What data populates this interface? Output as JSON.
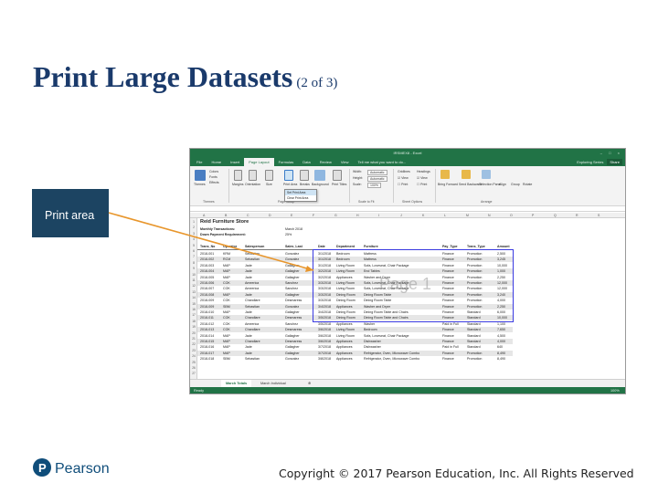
{
  "slide": {
    "title_main": "Print Large Datasets",
    "title_sub": "(2 of 3)",
    "callout": "Print area",
    "publisher": "Pearson",
    "copyright": "Copyright © 2017 Pearson Education, Inc. All Rights Reserved"
  },
  "excel": {
    "title": "IRSMEX8 - Excel",
    "tabs": [
      "File",
      "Home",
      "Insert",
      "Page Layout",
      "Formulas",
      "Data",
      "Review",
      "View"
    ],
    "active_tab": "Page Layout",
    "tell_me": "Tell me what you want to do...",
    "user": "Exploring Series",
    "share": "Share",
    "ribbon": {
      "themes": "Themes",
      "colors": "Colors",
      "fonts": "Fonts",
      "effects": "Effects",
      "margins": "Margins",
      "orientation": "Orientation",
      "size": "Size",
      "print_area": "Print Area",
      "breaks": "Breaks",
      "background": "Background",
      "print_titles": "Print Titles",
      "width": "Width:",
      "height": "Height:",
      "scale": "Scale:",
      "automatic": "Automatic",
      "scale_value": "100%",
      "gridlines": "Gridlines",
      "headings": "Headings",
      "view": "View",
      "print": "Print",
      "bring_forward": "Bring Forward",
      "send_backward": "Send Backward",
      "selection_pane": "Selection Pane",
      "align": "Align",
      "group": "Group",
      "rotate": "Rotate",
      "groups": [
        "Themes",
        "Page Setup",
        "Scale to Fit",
        "Sheet Options",
        "Arrange"
      ],
      "dropdown": [
        "Set Print Area",
        "Clear Print Area"
      ]
    },
    "columns": [
      "A",
      "B",
      "C",
      "D",
      "E",
      "F",
      "G",
      "H",
      "I",
      "J",
      "K",
      "L",
      "M",
      "N",
      "O",
      "P",
      "Q",
      "R",
      "S"
    ],
    "rows_header": [
      "1",
      "2",
      "3",
      "4",
      "5",
      "6",
      "7",
      "8",
      "9",
      "10",
      "11",
      "12",
      "13",
      "14",
      "15",
      "16",
      "17",
      "18",
      "19",
      "20",
      "21",
      "22",
      "23",
      "24",
      "25",
      "26",
      "27"
    ],
    "store_name": "Reid Furniture Store",
    "labels": {
      "monthly": "Monthly Transactions:",
      "month": "March 2018",
      "down_payment": "Down Payment Requirement:",
      "pct": "25%"
    },
    "table_headers": [
      "Trans_No",
      "Operator",
      "Salesperson",
      "Sales_Last",
      "Date",
      "Department",
      "Furniture",
      "Pay_Type",
      "Trans_Type",
      "Amount"
    ],
    "page_watermark": "Page 1",
    "data_rows": [
      [
        "2018-001",
        "KRM",
        "Sebastian",
        "Gonzalez",
        "3/1/2018",
        "Bedroom",
        "Mattress",
        "Finance",
        "Promotion",
        "2,500"
      ],
      [
        "2018-002",
        "RCM",
        "Sebastian",
        "Gonzalez",
        "3/1/2018",
        "Bedroom",
        "Mattress",
        "Finance",
        "Promotion",
        "3,245"
      ],
      [
        "2018-003",
        "MAP",
        "Jade",
        "Gallagher",
        "3/1/2018",
        "Living Room",
        "Sofa, Loveseat, Chair Package",
        "Finance",
        "Promotion",
        "10,000"
      ],
      [
        "2018-004",
        "MAP",
        "Jade",
        "Gallagher",
        "3/2/2018",
        "Living Room",
        "End Tables",
        "Finance",
        "Promotion",
        "1,000"
      ],
      [
        "2018-005",
        "MAP",
        "Jade",
        "Gallagher",
        "3/2/2018",
        "Appliances",
        "Washer and Dryer",
        "Finance",
        "Promotion",
        "2,250"
      ],
      [
        "2018-006",
        "COK",
        "Ameerica",
        "Sanchez",
        "3/3/2018",
        "Living Room",
        "Sofa, Loveseat, Chair Package",
        "Finance",
        "Promotion",
        "12,000"
      ],
      [
        "2018-007",
        "COK",
        "Ameerica",
        "Sanchez",
        "3/3/2018",
        "Living Room",
        "Sofa, Loveseat, Chair Package",
        "Finance",
        "Promotion",
        "12,000"
      ],
      [
        "2018-008",
        "MAP",
        "Jade",
        "Gallagher",
        "3/3/2018",
        "Dining Room",
        "Dining Room Table",
        "Finance",
        "Promotion",
        "3,240"
      ],
      [
        "2018-009",
        "COK",
        "Chandlare",
        "Desmaress",
        "3/3/2018",
        "Dining Room",
        "Dining Room Table",
        "Finance",
        "Promotion",
        "4,000"
      ],
      [
        "2018-009",
        "SBM",
        "Sebastian",
        "Gonzalez",
        "3/4/2018",
        "Appliances",
        "Washer and Dryer",
        "Finance",
        "Promotion",
        "2,250"
      ],
      [
        "2018-010",
        "MAP",
        "Jade",
        "Gallagher",
        "3/4/2018",
        "Dining Room",
        "Dining Room Table and Chairs",
        "Finance",
        "Standard",
        "6,000"
      ],
      [
        "2018-011",
        "COK",
        "Chandlare",
        "Desmaress",
        "3/5/2018",
        "Dining Room",
        "Dining Room Table and Chairs",
        "Finance",
        "Standard",
        "10,000"
      ],
      [
        "2018-012",
        "COK",
        "Ameerica",
        "Sanchez",
        "3/5/2018",
        "Appliances",
        "Washer",
        "Paid in Full",
        "Standard",
        "1,100"
      ],
      [
        "2018-013",
        "COK",
        "Chandlare",
        "Desmaress",
        "3/6/2018",
        "Living Room",
        "Bedroom",
        "Finance",
        "Standard",
        "7,650"
      ],
      [
        "2018-014",
        "MAP",
        "Jade",
        "Gallagher",
        "3/6/2018",
        "Living Room",
        "Sofa, Loveseat, Chair Package",
        "Finance",
        "Standard",
        "4,500"
      ],
      [
        "2018-015",
        "MAP",
        "Chandlare",
        "Desmaress",
        "3/6/2018",
        "Appliances",
        "Dishwasher",
        "Finance",
        "Standard",
        "4,000"
      ],
      [
        "2018-016",
        "MAP",
        "Jade",
        "Gallagher",
        "3/7/2018",
        "Appliances",
        "Dishwasher",
        "Paid in Full",
        "Standard",
        "640"
      ],
      [
        "2018-017",
        "MAP",
        "Jade",
        "Gallagher",
        "3/7/2018",
        "Appliances",
        "Refrigerator, Oven, Microwave Combo",
        "Finance",
        "Promotion",
        "8,490"
      ],
      [
        "2018-018",
        "SBM",
        "Sebastian",
        "Gonzalez",
        "3/8/2018",
        "Appliances",
        "Refrigerator, Oven, Microwave Combo",
        "Finance",
        "Promotion",
        "8,490"
      ]
    ],
    "sheet_tabs": [
      "March Totals",
      "March Individual"
    ],
    "status": {
      "ready": "Ready",
      "zoom": "100%"
    }
  }
}
